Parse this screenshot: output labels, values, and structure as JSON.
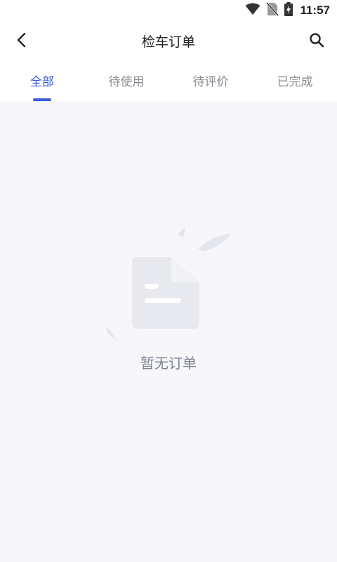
{
  "status_bar": {
    "time": "11:57",
    "icons": [
      "wifi-icon",
      "no-sim-icon",
      "battery-charging-icon"
    ]
  },
  "nav": {
    "title": "检车订单",
    "back_icon": "chevron-left-icon",
    "search_icon": "search-icon"
  },
  "tabs": [
    {
      "label": "全部",
      "active": true
    },
    {
      "label": "待使用",
      "active": false
    },
    {
      "label": "待评价",
      "active": false
    },
    {
      "label": "已完成",
      "active": false
    }
  ],
  "empty_state": {
    "icon": "empty-document-icon",
    "message": "暂无订单"
  },
  "colors": {
    "accent": "#3b5bd9",
    "background": "#f7f7f9",
    "header": "#ffffff",
    "inactive_tab": "#8a8a92",
    "empty_text": "#7f8495"
  }
}
